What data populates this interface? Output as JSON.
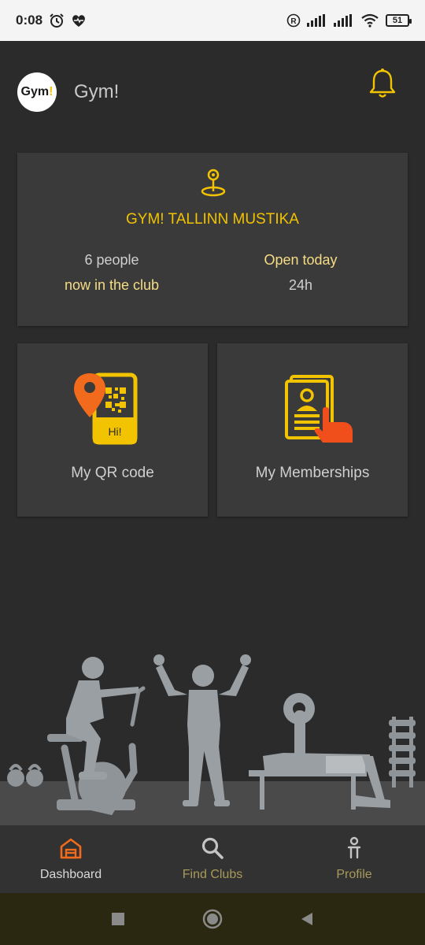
{
  "status_bar": {
    "time": "0:08",
    "battery_level": "51",
    "icons": [
      "alarm-icon",
      "heart-pulse-icon",
      "registered-icon",
      "signal-icon",
      "signal-icon",
      "wifi-icon",
      "battery-icon"
    ]
  },
  "header": {
    "logo_text": "Gym",
    "logo_mark": "!",
    "app_title": "Gym!",
    "icon": "bell-icon"
  },
  "club": {
    "name": "GYM! TALLINN MUSTIKA",
    "people_count": "6 people",
    "people_caption": "now in the club",
    "open_label": "Open today",
    "hours": "24h",
    "icon": "location-pin-icon"
  },
  "tiles": {
    "qr_label": "My QR code",
    "qr_phone_text": "Hi!",
    "memberships_label": "My Memberships"
  },
  "bottom_nav": {
    "dashboard": "Dashboard",
    "find_clubs": "Find Clubs",
    "profile": "Profile"
  },
  "colors": {
    "accent_yellow": "#f2c300",
    "accent_orange": "#f26a1b",
    "background": "#2b2b2b",
    "card": "#3a3a3a"
  }
}
